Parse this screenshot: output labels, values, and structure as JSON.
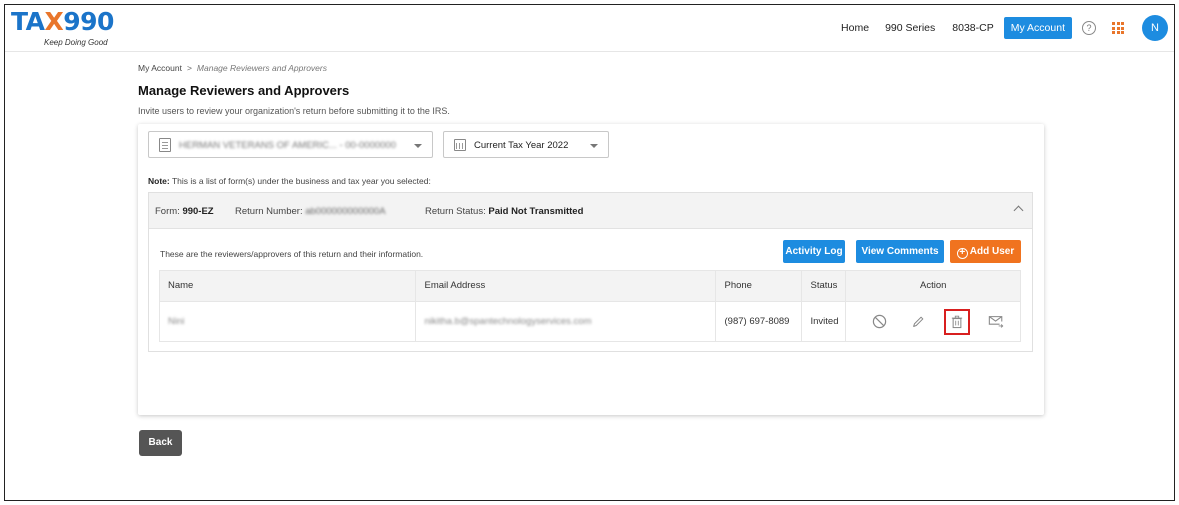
{
  "header": {
    "logo_brand_left": "TA",
    "logo_brand_x": "X",
    "logo_brand_right": "990",
    "logo_tagline": "Keep Doing Good",
    "nav": {
      "home": "Home",
      "series": "990 Series",
      "form8038": "8038-CP",
      "my_account": "My Account"
    },
    "help_icon": "question-circle-icon",
    "apps_icon": "grid-icon",
    "avatar_letter": "N",
    "colors": {
      "primary": "#1d8ce0",
      "accent": "#f0731f",
      "highlight": "#d81f1f"
    }
  },
  "breadcrumb": {
    "root": "My Account",
    "separator": ">",
    "current": "Manage Reviewers and Approvers"
  },
  "page": {
    "title": "Manage Reviewers and Approvers",
    "subtitle": "Invite users to review your organization's return before submitting it to the IRS."
  },
  "filters": {
    "organization": "HERMAN VETERANS OF AMERIC... - 00-0000000",
    "tax_year": "Current Tax Year 2022"
  },
  "note": {
    "label": "Note:",
    "text": "This is a list of form(s) under the business and tax year you selected:"
  },
  "form": {
    "form_label": "Form:",
    "form_value": "990-EZ",
    "return_label": "Return Number:",
    "return_value": "ab000000000000A",
    "status_label": "Return Status:",
    "status_value": "Paid Not Transmitted"
  },
  "reviewers": {
    "intro": "These are the reviewers/approvers of this return and their information.",
    "buttons": {
      "activity_log": "Activity Log",
      "view_comments": "View Comments",
      "add_user": "Add User"
    },
    "columns": {
      "name": "Name",
      "email": "Email Address",
      "phone": "Phone",
      "status": "Status",
      "action": "Action"
    },
    "rows": [
      {
        "name": "Nini",
        "email": "nikitha.b@spantechnologyservices.com",
        "phone": "(987) 697-8089",
        "status": "Invited",
        "actions": [
          "block-icon",
          "pencil-icon",
          "trash-icon",
          "email-forward-icon"
        ]
      }
    ]
  },
  "footer": {
    "back": "Back"
  }
}
